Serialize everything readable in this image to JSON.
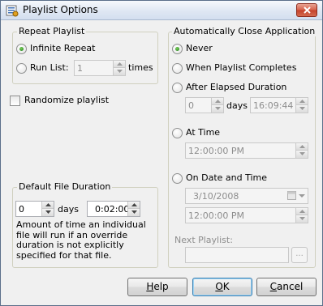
{
  "window": {
    "title": "Playlist Options"
  },
  "repeat": {
    "group_title": "Repeat Playlist",
    "infinite_label": "Infinite Repeat",
    "run_list_label": "Run List:",
    "run_list_value": "1",
    "times_label": "times",
    "selected": "infinite"
  },
  "randomize": {
    "label": "Randomize playlist",
    "checked": false
  },
  "default_duration": {
    "group_title": "Default File Duration",
    "days_value": "0",
    "days_label": "days",
    "time_value": "0:02:00",
    "description": "Amount of time an individual file will run if an override duration is not explicitly specified for that file."
  },
  "auto_close": {
    "group_title": "Automatically Close Application",
    "selected": "never",
    "options": {
      "never": "Never",
      "when_complete": "When Playlist Completes",
      "after_elapsed": "After Elapsed Duration",
      "at_time": "At Time",
      "on_date_time": "On Date and Time"
    },
    "elapsed_days_value": "0",
    "elapsed_days_label": "days",
    "elapsed_time_value": "16:09:44",
    "at_time_value": "12:00:00 PM",
    "date_value": "3/10/2008",
    "date_time_value": "12:00:00 PM",
    "next_playlist_label": "Next Playlist:",
    "next_playlist_value": "",
    "browse_label": "..."
  },
  "buttons": {
    "help": "Help",
    "ok": "OK",
    "cancel": "Cancel"
  },
  "icons": {
    "app": "playlist-app-icon",
    "close": "close-x-icon",
    "spin_up": "spin-up-arrow-icon",
    "spin_down": "spin-down-arrow-icon",
    "calendar": "calendar-dropdown-icon"
  }
}
